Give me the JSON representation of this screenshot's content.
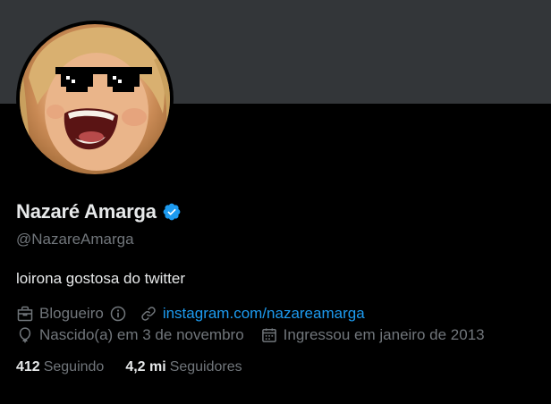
{
  "profile": {
    "display_name": "Nazaré Amarga",
    "handle": "@NazareAmarga",
    "bio": "loirona gostosa do twitter",
    "verified": true,
    "verified_color": "#1d9bf0"
  },
  "meta": {
    "category": "Blogueiro",
    "category_icon": "briefcase-icon",
    "info_icon": "info-circle-icon",
    "link_text": "instagram.com/nazareamarga",
    "link_icon": "link-icon",
    "birthday": "Nascido(a) em 3 de novembro",
    "birthday_icon": "balloon-icon",
    "joined": "Ingressou em janeiro de 2013",
    "joined_icon": "calendar-icon"
  },
  "stats": {
    "following_count": "412",
    "following_label": "Seguindo",
    "followers_count": "4,2 mi",
    "followers_label": "Seguidores"
  },
  "colors": {
    "background": "#000000",
    "banner": "#333639",
    "text_primary": "#e7e9ea",
    "text_secondary": "#71767b",
    "accent": "#1d9bf0"
  }
}
